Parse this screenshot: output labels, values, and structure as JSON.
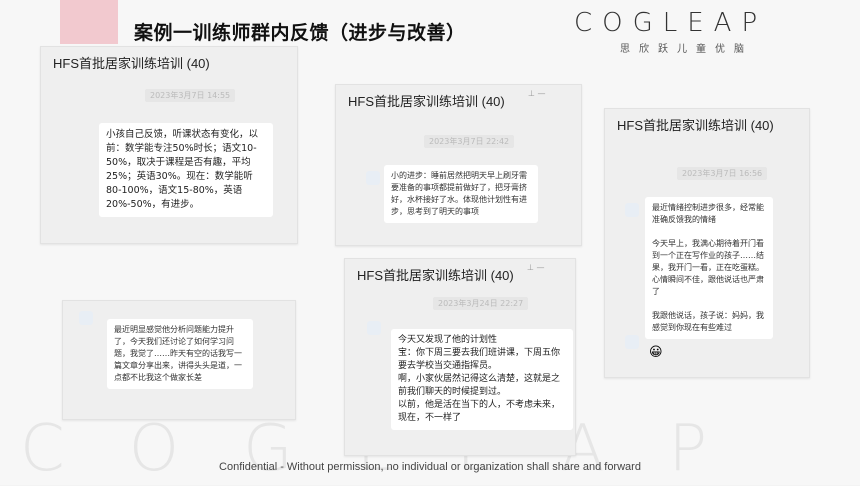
{
  "header": {
    "title_bold": "案例一",
    "title_rest": "训练师群内反馈（进步与改善）"
  },
  "logo": {
    "word": "COGLEAP",
    "sub": "思欣跃儿童优脑"
  },
  "watermark": "COGLEAP",
  "chats": [
    {
      "title": "HFS首批居家训练培训 (40)",
      "timestamp": "2023年3月7日 14:55",
      "message": "小孩自己反馈，听课状态有变化，以前：数学能专注50%时长；语文10-50%，取决于课程是否有趣，平均25%；英语30%。现在：数学能听80-100%，语文15-80%，英语20%-50%，有进步。"
    },
    {
      "title": "HFS首批居家训练培训 (40)",
      "timestamp": "2023年3月7日 22:42",
      "message": "小的进步：睡前居然把明天早上刷牙需要准备的事项都提前做好了，把牙膏挤好，水杯接好了水。体现他计划性有进步，思考到了明天的事项"
    },
    {
      "title": "HFS首批居家训练培训 (40)",
      "timestamp": "2023年3月7日 16:56",
      "message": "最近情绪控制进步很多，经常能准确反馈我的情绪\n\n今天早上，我满心期待着开门看到一个正在写作业的孩子……结果，我开门一看，正在吃蛋糕。心情瞬间不佳，跟他说话也严肃了\n\n我跟他说话，孩子说：妈妈，我感觉到你现在有些难过",
      "emoji": "😀"
    },
    {
      "title": "",
      "timestamp": "",
      "message": "最近明显感觉他分析问题能力提升了，今天我们还讨论了如何学习问题，我觉了……昨天有空的话我写一篇文章分享出来，讲得头头是道，一点都不比我这个做家长差"
    },
    {
      "title": "HFS首批居家训练培训 (40)",
      "timestamp": "2023年3月24日 22:27",
      "message": "今天又发现了他的计划性\n宝：你下周三要去我们班讲课，下周五你要去学校当交通指挥员。\n啊，小家伙居然记得这么清楚，这就是之前我们聊天的时候提到过。\n以前，他是活在当下的人，不考虑未来，现在，不一样了"
    }
  ],
  "footer": "Confidential - Without permission, no individual or organization shall share and forward",
  "colors": {
    "pink": "#f2c9cf",
    "panel": "#efefef",
    "bubble": "#ffffff"
  }
}
